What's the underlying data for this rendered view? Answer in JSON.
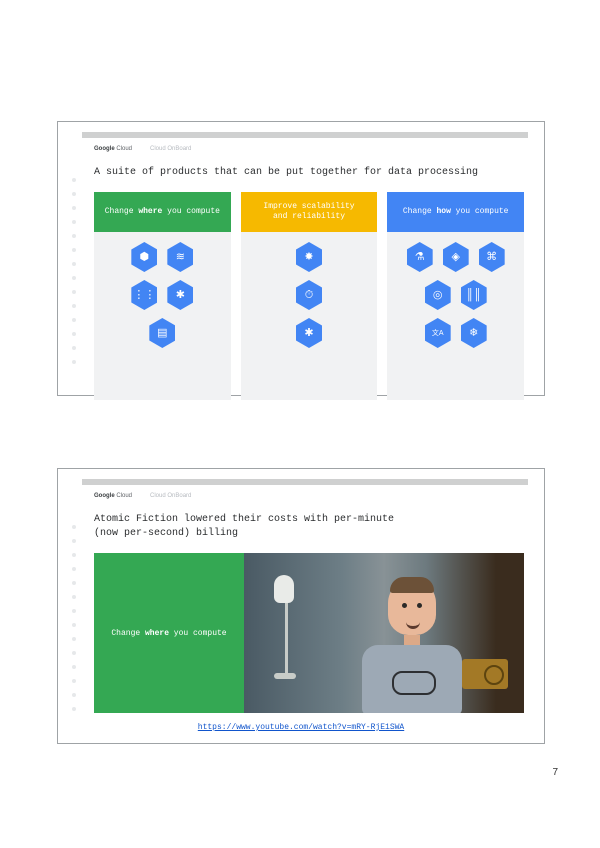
{
  "page_number": "7",
  "brand": {
    "name_strong": "Google",
    "name_rest": " Cloud",
    "sub": "Cloud OnBoard"
  },
  "slide1": {
    "title": "A suite of products that can be put together for data processing",
    "cols": [
      {
        "head_pre": "Change ",
        "head_bold": "where",
        "head_post": " you compute",
        "rows": [
          [
            "compute-engine-icon",
            "cloud-storage-icon"
          ],
          [
            "pubsub-icon",
            "dataflow-icon"
          ],
          [
            "datastore-icon"
          ]
        ]
      },
      {
        "head_line1": "Improve scalability",
        "head_line2": "and reliability",
        "rows": [
          [
            "dataproc-icon"
          ],
          [
            "cloud-scheduler-icon"
          ],
          [
            "dataflow-icon"
          ]
        ]
      },
      {
        "head_pre": "Change ",
        "head_bold": "how",
        "head_post": " you compute",
        "rows": [
          [
            "ml-engine-icon",
            "vision-api-icon",
            "genomics-icon"
          ],
          [
            "bigquery-icon",
            "speech-api-icon"
          ],
          [
            "translate-api-icon",
            "nlp-api-icon"
          ]
        ]
      }
    ]
  },
  "slide2": {
    "title_line1": "Atomic Fiction lowered their costs with per-minute",
    "title_line2": "(now per-second) billing",
    "green_pre": "Change ",
    "green_bold": "where",
    "green_post": " you compute",
    "link_text": "https://www.youtube.com/watch?v=mRY-RjE1SWA",
    "link_href": "https://www.youtube.com/watch?v=mRY-RjE1SWA"
  },
  "glyphs": {
    "compute-engine-icon": "⬢",
    "cloud-storage-icon": "≋",
    "pubsub-icon": "⋮⋮",
    "dataflow-icon": "✱",
    "datastore-icon": "▤",
    "dataproc-icon": "✸",
    "cloud-scheduler-icon": "⏱",
    "ml-engine-icon": "⚗",
    "vision-api-icon": "◈",
    "genomics-icon": "⌘",
    "bigquery-icon": "◎",
    "speech-api-icon": "║║",
    "translate-api-icon": "文A",
    "nlp-api-icon": "❄"
  }
}
